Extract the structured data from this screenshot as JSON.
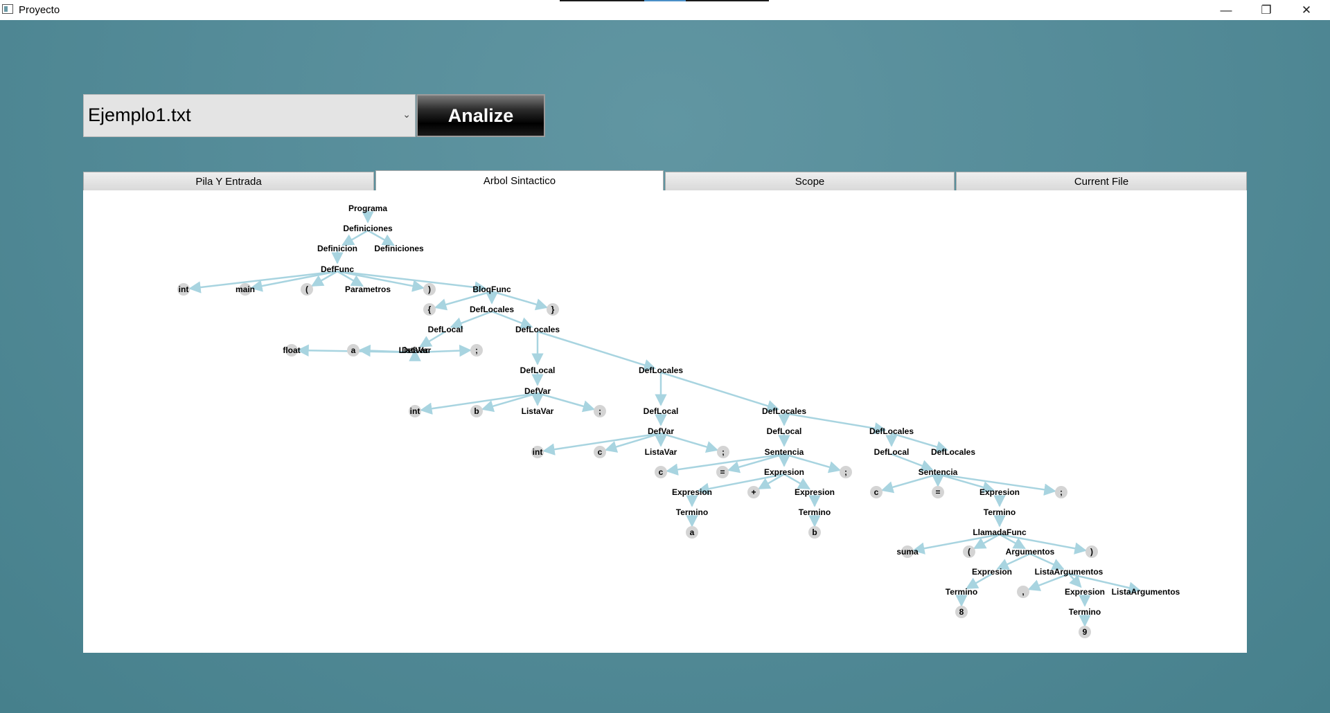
{
  "window": {
    "title": "Proyecto",
    "minimize_glyph": "—",
    "maximize_glyph": "❐",
    "close_glyph": "✕"
  },
  "file_select": {
    "value": "Ejemplo1.txt",
    "arrow_glyph": "⌄"
  },
  "analyze_button": {
    "label": "Analize"
  },
  "tabs": [
    {
      "label": "Pila Y Entrada",
      "active": false
    },
    {
      "label": "Arbol Sintactico",
      "active": true
    },
    {
      "label": "Scope",
      "active": false
    },
    {
      "label": "Current File",
      "active": false
    }
  ],
  "colors": {
    "background": "#558c99",
    "edge": "#a8d4e0",
    "leaf_circle": "#d4d4d4"
  },
  "tree": {
    "nodes": [
      {
        "id": 0,
        "label": "Programa",
        "parent": null,
        "leaf": false
      },
      {
        "id": 1,
        "label": "Definiciones",
        "parent": 0,
        "leaf": false
      },
      {
        "id": 2,
        "label": "Definicion",
        "parent": 1,
        "leaf": false
      },
      {
        "id": 3,
        "label": "Definiciones",
        "parent": 1,
        "leaf": false
      },
      {
        "id": 4,
        "label": "DefFunc",
        "parent": 2,
        "leaf": false
      },
      {
        "id": 5,
        "label": "int",
        "parent": 4,
        "leaf": true
      },
      {
        "id": 6,
        "label": "main",
        "parent": 4,
        "leaf": true
      },
      {
        "id": 7,
        "label": "(",
        "parent": 4,
        "leaf": true
      },
      {
        "id": 8,
        "label": "Parametros",
        "parent": 4,
        "leaf": false
      },
      {
        "id": 9,
        "label": ")",
        "parent": 4,
        "leaf": true
      },
      {
        "id": 10,
        "label": "BloqFunc",
        "parent": 4,
        "leaf": false
      },
      {
        "id": 11,
        "label": "{",
        "parent": 10,
        "leaf": true
      },
      {
        "id": 12,
        "label": "DefLocales",
        "parent": 10,
        "leaf": false
      },
      {
        "id": 13,
        "label": "}",
        "parent": 10,
        "leaf": true
      },
      {
        "id": 14,
        "label": "DefLocal",
        "parent": 12,
        "leaf": false
      },
      {
        "id": 15,
        "label": "DefLocales",
        "parent": 12,
        "leaf": false
      },
      {
        "id": 16,
        "label": "DefVar",
        "parent": 14,
        "leaf": false
      },
      {
        "id": 17,
        "label": "float",
        "parent": 16,
        "leaf": true
      },
      {
        "id": 18,
        "label": "a",
        "parent": 16,
        "leaf": true
      },
      {
        "id": 19,
        "label": "ListaVar",
        "parent": 16,
        "leaf": false
      },
      {
        "id": 20,
        "label": ";",
        "parent": 16,
        "leaf": true
      },
      {
        "id": 21,
        "label": "DefLocal",
        "parent": 15,
        "leaf": false
      },
      {
        "id": 22,
        "label": "DefLocales",
        "parent": 15,
        "leaf": false
      },
      {
        "id": 23,
        "label": "DefVar",
        "parent": 21,
        "leaf": false
      },
      {
        "id": 24,
        "label": "int",
        "parent": 23,
        "leaf": true
      },
      {
        "id": 25,
        "label": "b",
        "parent": 23,
        "leaf": true
      },
      {
        "id": 26,
        "label": "ListaVar",
        "parent": 23,
        "leaf": false
      },
      {
        "id": 27,
        "label": ";",
        "parent": 23,
        "leaf": true
      },
      {
        "id": 28,
        "label": "DefLocal",
        "parent": 22,
        "leaf": false
      },
      {
        "id": 29,
        "label": "DefLocales",
        "parent": 22,
        "leaf": false
      },
      {
        "id": 30,
        "label": "DefVar",
        "parent": 28,
        "leaf": false
      },
      {
        "id": 31,
        "label": "int",
        "parent": 30,
        "leaf": true
      },
      {
        "id": 32,
        "label": "c",
        "parent": 30,
        "leaf": true
      },
      {
        "id": 33,
        "label": "ListaVar",
        "parent": 30,
        "leaf": false
      },
      {
        "id": 34,
        "label": ";",
        "parent": 30,
        "leaf": true
      },
      {
        "id": 35,
        "label": "DefLocal",
        "parent": 29,
        "leaf": false
      },
      {
        "id": 36,
        "label": "DefLocales",
        "parent": 29,
        "leaf": false
      },
      {
        "id": 37,
        "label": "Sentencia",
        "parent": 35,
        "leaf": false
      },
      {
        "id": 38,
        "label": "c",
        "parent": 37,
        "leaf": true
      },
      {
        "id": 39,
        "label": "=",
        "parent": 37,
        "leaf": true
      },
      {
        "id": 40,
        "label": "Expresion",
        "parent": 37,
        "leaf": false
      },
      {
        "id": 41,
        "label": ";",
        "parent": 37,
        "leaf": true
      },
      {
        "id": 42,
        "label": "Expresion",
        "parent": 40,
        "leaf": false
      },
      {
        "id": 43,
        "label": "+",
        "parent": 40,
        "leaf": true
      },
      {
        "id": 44,
        "label": "Expresion",
        "parent": 40,
        "leaf": false
      },
      {
        "id": 45,
        "label": "Termino",
        "parent": 42,
        "leaf": false
      },
      {
        "id": 46,
        "label": "a",
        "parent": 45,
        "leaf": true
      },
      {
        "id": 47,
        "label": "Termino",
        "parent": 44,
        "leaf": false
      },
      {
        "id": 48,
        "label": "b",
        "parent": 47,
        "leaf": true
      },
      {
        "id": 49,
        "label": "DefLocal",
        "parent": 36,
        "leaf": false
      },
      {
        "id": 50,
        "label": "DefLocales",
        "parent": 36,
        "leaf": false
      },
      {
        "id": 51,
        "label": "Sentencia",
        "parent": 49,
        "leaf": false
      },
      {
        "id": 52,
        "label": "c",
        "parent": 51,
        "leaf": true
      },
      {
        "id": 53,
        "label": "=",
        "parent": 51,
        "leaf": true
      },
      {
        "id": 54,
        "label": "Expresion",
        "parent": 51,
        "leaf": false
      },
      {
        "id": 55,
        "label": ";",
        "parent": 51,
        "leaf": true
      },
      {
        "id": 56,
        "label": "Termino",
        "parent": 54,
        "leaf": false
      },
      {
        "id": 57,
        "label": "LlamadaFunc",
        "parent": 56,
        "leaf": false
      },
      {
        "id": 58,
        "label": "suma",
        "parent": 57,
        "leaf": true
      },
      {
        "id": 59,
        "label": "(",
        "parent": 57,
        "leaf": true
      },
      {
        "id": 60,
        "label": "Argumentos",
        "parent": 57,
        "leaf": false
      },
      {
        "id": 61,
        "label": ")",
        "parent": 57,
        "leaf": true
      },
      {
        "id": 62,
        "label": "Expresion",
        "parent": 60,
        "leaf": false
      },
      {
        "id": 63,
        "label": "ListaArgumentos",
        "parent": 60,
        "leaf": false
      },
      {
        "id": 64,
        "label": "Termino",
        "parent": 62,
        "leaf": false
      },
      {
        "id": 65,
        "label": "8",
        "parent": 64,
        "leaf": true
      },
      {
        "id": 66,
        "label": ",",
        "parent": 63,
        "leaf": true
      },
      {
        "id": 67,
        "label": "Expresion",
        "parent": 63,
        "leaf": false
      },
      {
        "id": 68,
        "label": "ListaArgumentos",
        "parent": 63,
        "leaf": false
      },
      {
        "id": 69,
        "label": "Termino",
        "parent": 67,
        "leaf": false
      },
      {
        "id": 70,
        "label": "9",
        "parent": 69,
        "leaf": true
      }
    ]
  }
}
